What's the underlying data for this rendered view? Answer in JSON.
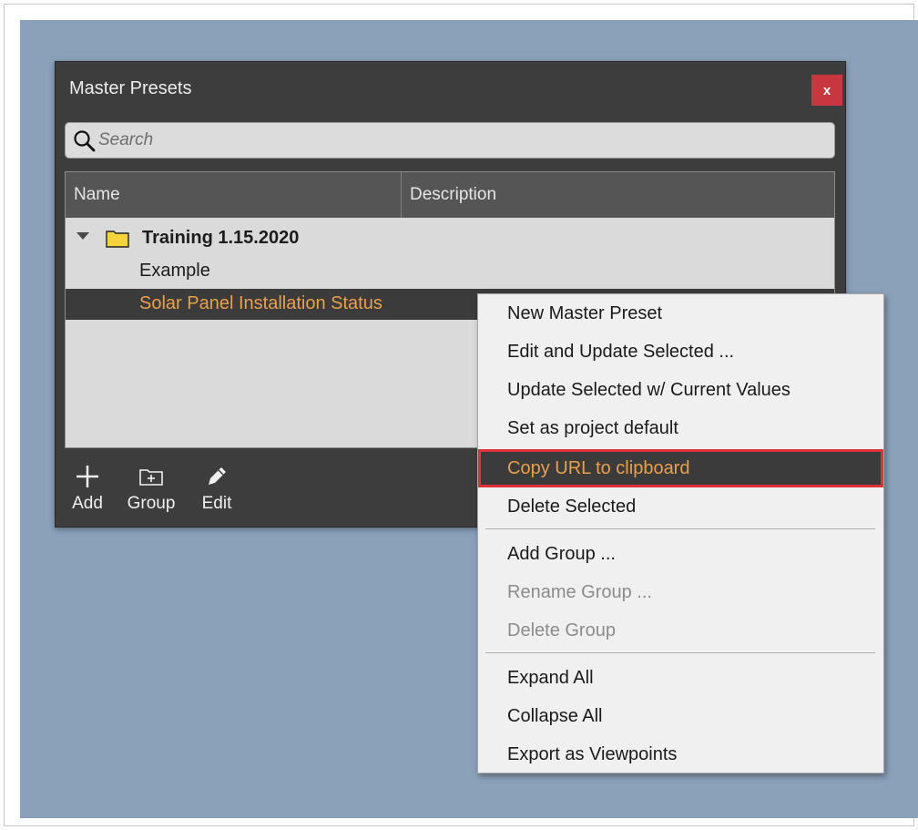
{
  "window": {
    "title": "Master Presets",
    "close_label": "x"
  },
  "search": {
    "placeholder": "Search",
    "value": ""
  },
  "table": {
    "columns": [
      "Name",
      "Description"
    ],
    "group": {
      "label": "Training 1.15.2020",
      "expanded": true
    },
    "items": [
      {
        "name": "Example",
        "description": ""
      },
      {
        "name": "Solar Panel Installation Status",
        "description": "",
        "selected": true
      }
    ]
  },
  "toolbar": {
    "add_label": "Add",
    "group_label": "Group",
    "edit_label": "Edit"
  },
  "context_menu": {
    "items": [
      {
        "label": "New Master Preset"
      },
      {
        "label": "Edit and Update Selected ..."
      },
      {
        "label": "Update Selected w/ Current Values"
      },
      {
        "label": "Set as project default"
      },
      {
        "label": "Copy URL to clipboard",
        "highlighted": true
      },
      {
        "label": "Delete Selected"
      },
      {
        "label": "Add Group ..."
      },
      {
        "label": "Rename Group ...",
        "disabled": true
      },
      {
        "label": "Delete Group",
        "disabled": true
      },
      {
        "label": "Expand All"
      },
      {
        "label": "Collapse All"
      },
      {
        "label": "Export as Viewpoints"
      }
    ]
  },
  "colors": {
    "desktop": "#8aa1b9",
    "panel": "#3d3d3d",
    "selection_text": "#eaa04b",
    "highlight_border": "#e0313b",
    "close_button": "#c8373f",
    "folder": "#f5d33a"
  }
}
